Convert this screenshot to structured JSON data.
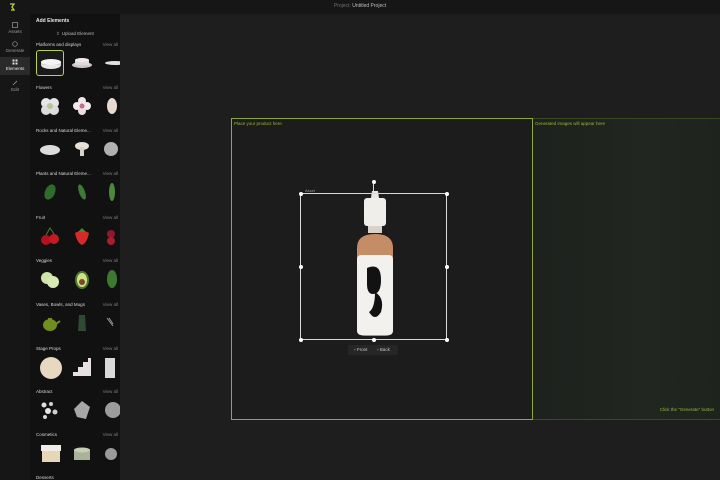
{
  "header": {
    "project_prefix": "Project:",
    "project_name": "Untitled Project"
  },
  "rail": [
    {
      "label": "Assets",
      "icon": "assets-icon"
    },
    {
      "label": "Generate",
      "icon": "generate-icon"
    },
    {
      "label": "Elements",
      "icon": "elements-icon",
      "active": true
    },
    {
      "label": "Edit",
      "icon": "edit-icon"
    }
  ],
  "panel": {
    "title": "Add Elements",
    "upload_label": "Upload Element",
    "view_all": "View all",
    "sections": [
      {
        "title": "Platforms and displays"
      },
      {
        "title": "Flowers"
      },
      {
        "title": "Rocks and Natural Eleme..."
      },
      {
        "title": "Plants and Natural Eleme..."
      },
      {
        "title": "Fruit"
      },
      {
        "title": "Veggies"
      },
      {
        "title": "Vases, Bowls, and Mugs"
      },
      {
        "title": "Stage Props"
      },
      {
        "title": "Abstract"
      },
      {
        "title": "Cosmetics"
      },
      {
        "title": "Desserts"
      }
    ]
  },
  "canvas": {
    "place_label": "Place your product here",
    "generated_label": "Generated images will appear here",
    "generate_hint": "Click the \"Generate\" button",
    "asset_tag": "Asset",
    "face_front": "Front",
    "face_back": "Back"
  },
  "colors": {
    "accent": "#95b53c",
    "panel_bg": "#111111",
    "canvas_bg": "#1e1e1e"
  }
}
